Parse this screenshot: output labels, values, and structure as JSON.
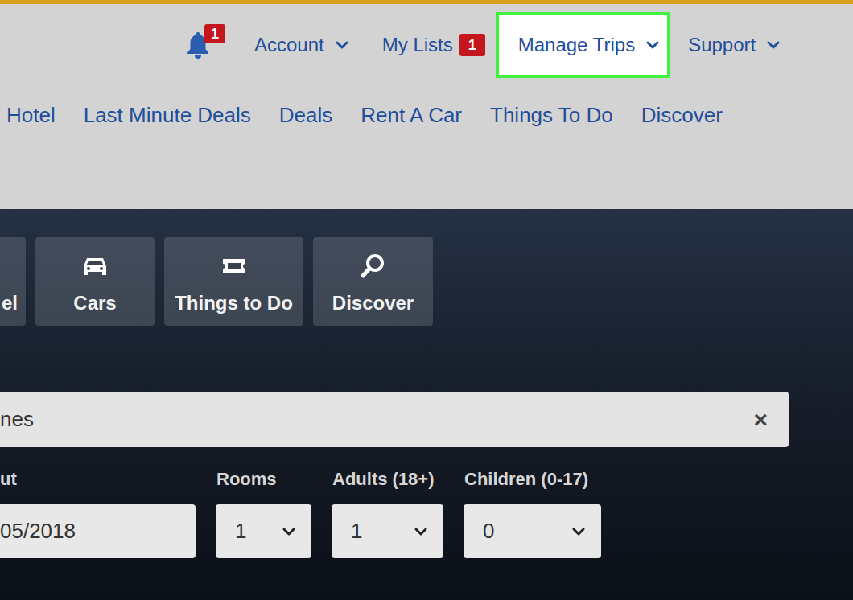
{
  "top_nav": {
    "notifications": {
      "badge": "1"
    },
    "items": [
      {
        "label": "Account",
        "badge": null,
        "dropdown": true,
        "selected": false
      },
      {
        "label": "My Lists",
        "badge": "1",
        "dropdown": false,
        "selected": false
      },
      {
        "label": "Manage Trips",
        "badge": null,
        "dropdown": true,
        "selected": true
      },
      {
        "label": "Support",
        "badge": null,
        "dropdown": true,
        "selected": false
      }
    ]
  },
  "main_nav": {
    "items": [
      {
        "label": "Hotel"
      },
      {
        "label": "Last Minute Deals"
      },
      {
        "label": "Deals"
      },
      {
        "label": "Rent A Car"
      },
      {
        "label": "Things To Do"
      },
      {
        "label": "Discover"
      }
    ]
  },
  "search_tabs": [
    {
      "label": "el",
      "kind": "hotel"
    },
    {
      "label": "Cars",
      "kind": "car"
    },
    {
      "label": "Things to Do",
      "kind": "ticket"
    },
    {
      "label": "Discover",
      "kind": "search"
    }
  ],
  "destination": {
    "value": "nes",
    "clear": "×"
  },
  "fields": [
    {
      "label": "ut",
      "value": "05/2018",
      "kind": "text"
    },
    {
      "label": "Rooms",
      "value": "1",
      "kind": "select"
    },
    {
      "label": "Adults (18+)",
      "value": "1",
      "kind": "select"
    },
    {
      "label": "Children (0-17)",
      "value": "0",
      "kind": "select"
    }
  ]
}
